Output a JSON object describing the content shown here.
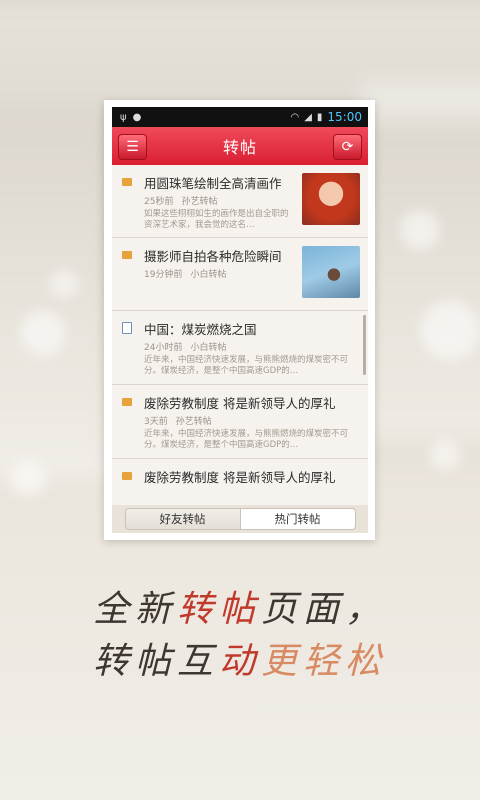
{
  "statusbar": {
    "left_icons": [
      "usb-icon",
      "android-icon"
    ],
    "right_icons": [
      "wifi-icon",
      "signal-icon",
      "battery-icon"
    ],
    "time": "15:00"
  },
  "header": {
    "title": "转帖",
    "menu_icon": "☰",
    "refresh_icon": "⟳"
  },
  "feed": {
    "items": [
      {
        "title": "用圆珠笔绘制全高清画作",
        "time": "25秒前",
        "author": "孙艺转帖",
        "desc": "如果这些栩栩如生的画作是出自全职的资深艺术家，我会觉的这名…"
      },
      {
        "title": "摄影师自拍各种危险瞬间",
        "time": "19分钟前",
        "author": "小白转帖"
      },
      {
        "title": "中国：煤炭燃烧之国",
        "time": "24小时前",
        "author": "小白转帖",
        "desc": "近年来，中国经济快速发展，与熊熊燃烧的煤炭密不可分。煤炭经济，是整个中国高速GDP的…"
      },
      {
        "title": "废除劳教制度  将是新领导人的厚礼",
        "time": "3天前",
        "author": "孙艺转帖",
        "desc": "近年来，中国经济快速发展，与熊熊燃烧的煤炭密不可分。煤炭经济，是整个中国高速GDP的…"
      },
      {
        "title": "废除劳教制度  将是新领导人的厚礼"
      }
    ]
  },
  "tabs": {
    "friends": "好友转帖",
    "hot": "热门转帖"
  },
  "slogan": {
    "l1a": "全新",
    "l1b": "转帖",
    "l1c": "页面，",
    "l2a": "转帖",
    "l2b": "互",
    "l2c": "动",
    "l2d": "更轻松"
  }
}
